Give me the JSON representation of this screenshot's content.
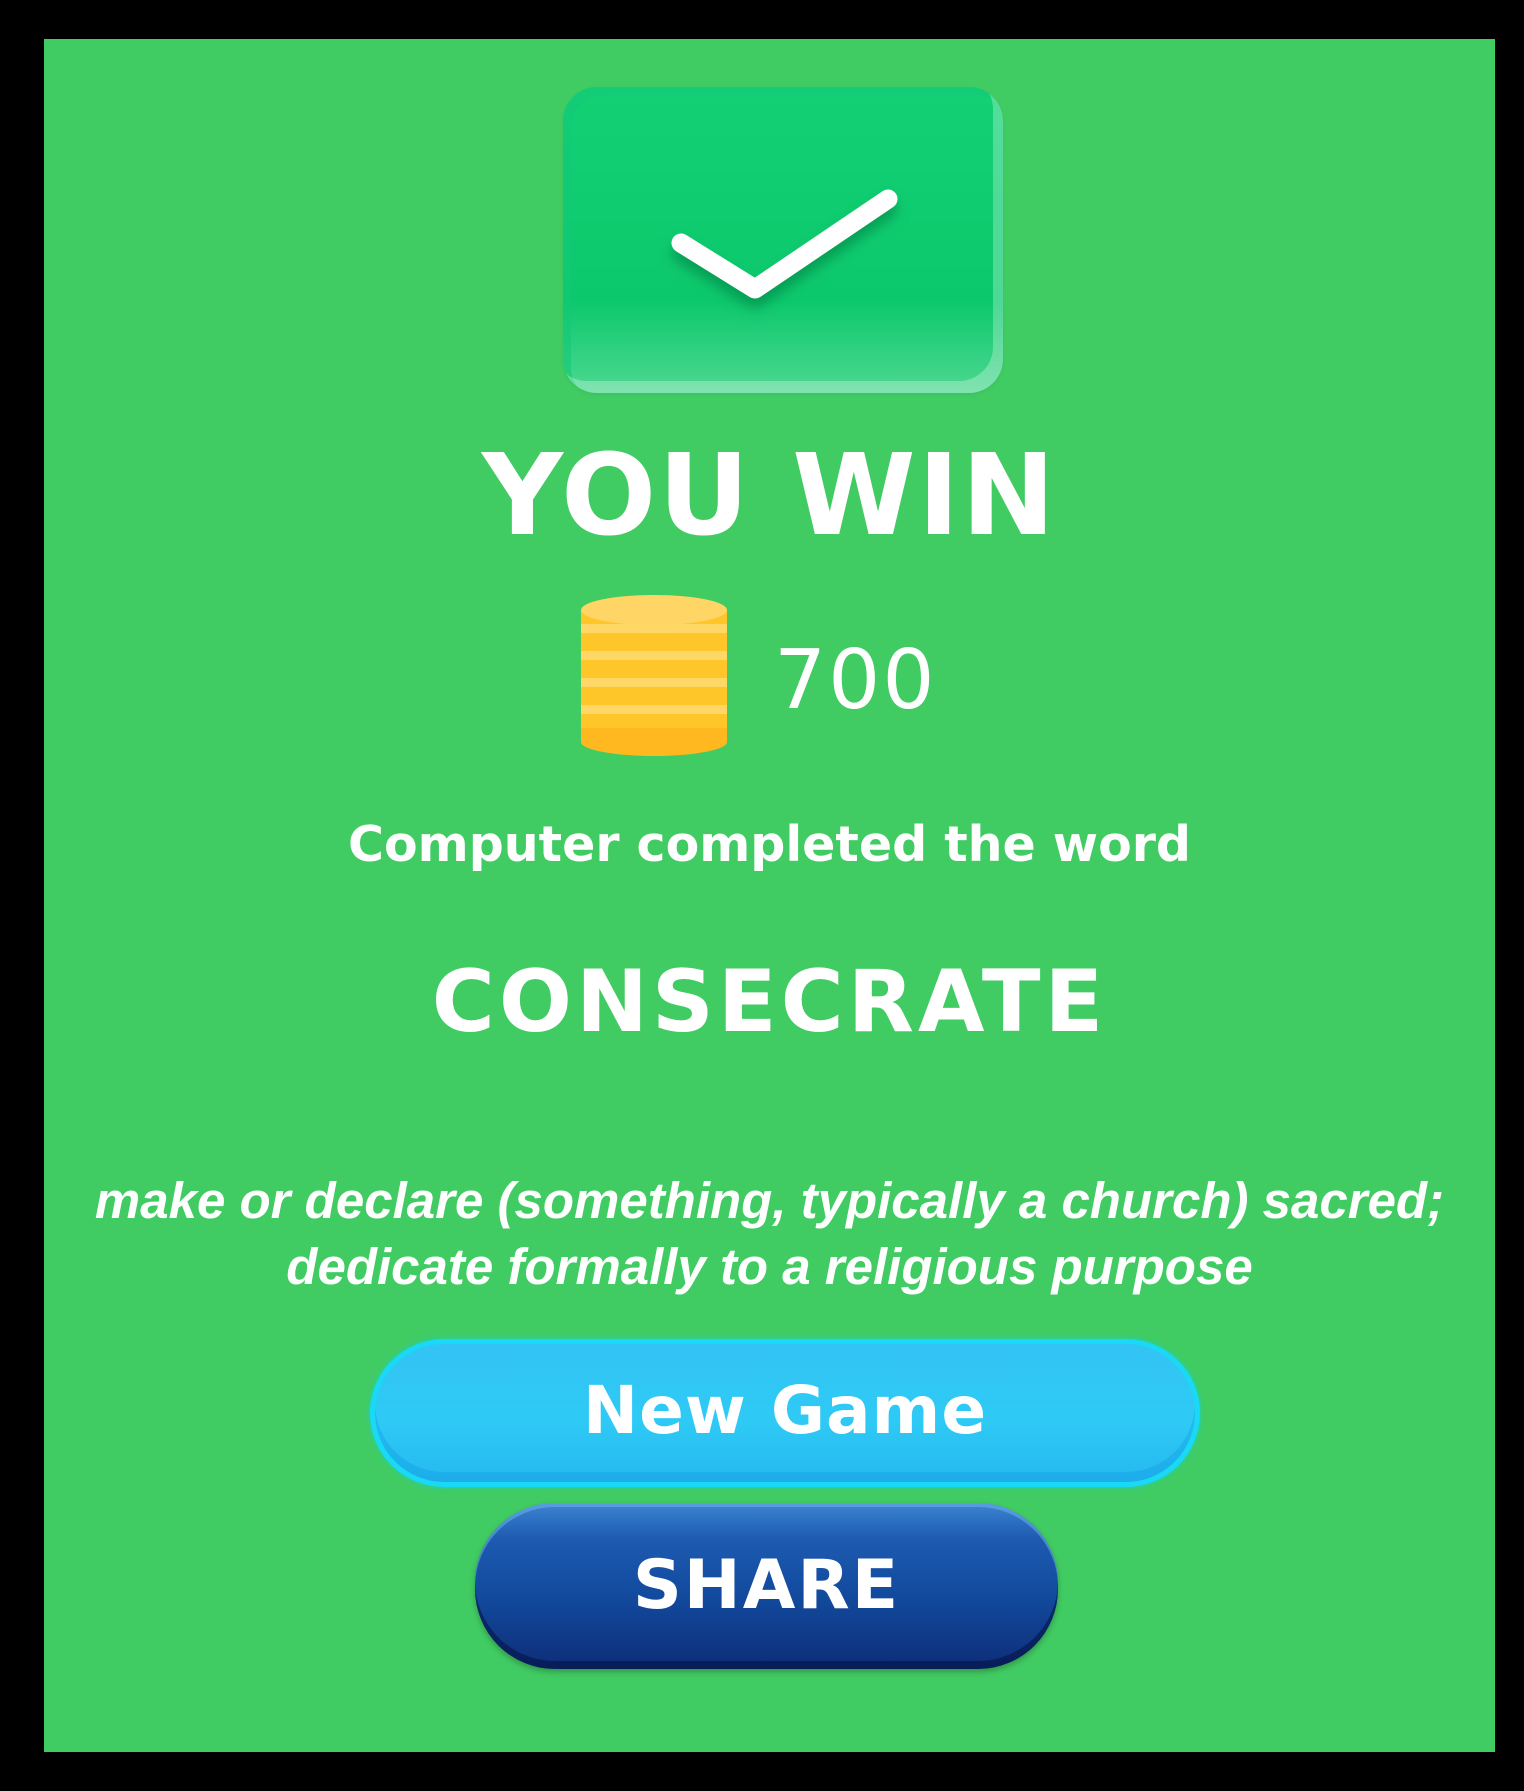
{
  "result": {
    "icon": "checkmark-icon",
    "title": "YOU WIN",
    "coins_icon": "coin-stack-icon",
    "coins": "700",
    "message": "Computer completed the word",
    "word": "CONSECRATE",
    "definition": "make or declare (something, typically a church) sacred; dedicate formally to a religious purpose"
  },
  "buttons": {
    "new_game": "New Game",
    "share": "SHARE"
  },
  "colors": {
    "background": "#41CB63",
    "frame": "#000000",
    "check_tile": "#12D174",
    "new_game_button": "#2ECAF5",
    "share_button": "#124B9E",
    "coin": "#FFC629"
  }
}
